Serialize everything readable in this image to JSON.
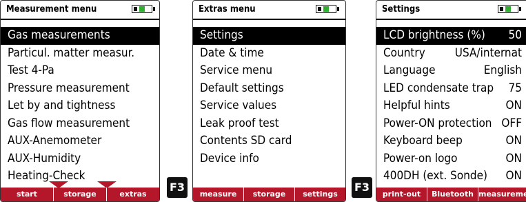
{
  "screens": [
    {
      "title": "Measurement menu",
      "items": [
        "Gas measurements",
        "Particul. matter measur.",
        "Test 4-Pa",
        "Pressure measurement",
        "Let by and tightness",
        "Gas flow measurement",
        "AUX-Anemometer",
        "AUX-Humidity",
        "Heating-Check"
      ],
      "selected_index": 0,
      "softkeys": [
        "start",
        "storage",
        "extras"
      ]
    },
    {
      "title": "Extras menu",
      "items": [
        "Settings",
        "Date & time",
        "Service menu",
        "Default settings",
        "Service values",
        "Leak proof test",
        "Contents SD card",
        "Device info"
      ],
      "selected_index": 0,
      "softkeys": [
        "measure",
        "storage",
        "settings"
      ]
    },
    {
      "title": "Settings",
      "items": [
        {
          "label": "LCD brightness (%)",
          "value": "50"
        },
        {
          "label": "Country",
          "value": "USA/internat"
        },
        {
          "label": "Language",
          "value": "English"
        },
        {
          "label": "LED condensate trap",
          "value": "75"
        },
        {
          "label": "Helpful hints",
          "value": "ON"
        },
        {
          "label": "Power-ON protection",
          "value": "OFF"
        },
        {
          "label": "Keyboard beep",
          "value": "ON"
        },
        {
          "label": "Power-on logo",
          "value": "ON"
        },
        {
          "label": "400DH (ext. Sonde)",
          "value": "ON"
        }
      ],
      "selected_index": 0,
      "softkeys": [
        "print-out",
        "Bluetooth",
        "measurement"
      ]
    }
  ],
  "keys": {
    "f3_label": "F3"
  },
  "colors": {
    "softkey_bar": "#b5172a",
    "battery": "#2fae2f",
    "selection": "#000000"
  }
}
